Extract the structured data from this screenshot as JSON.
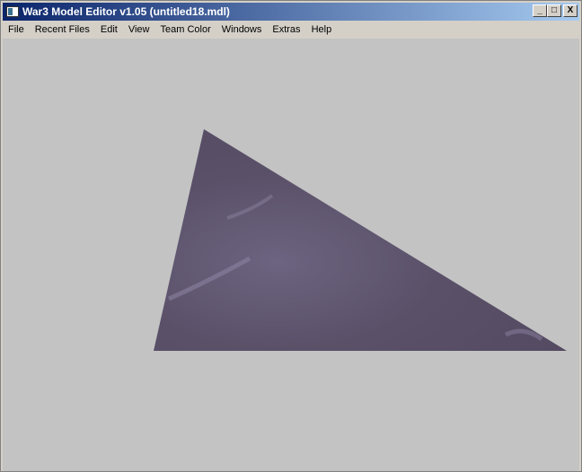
{
  "window": {
    "title": "War3 Model Editor v1.05 (untitled18.mdl)",
    "controls": {
      "minimize": "_",
      "maximize": "□",
      "close": "X"
    }
  },
  "menu": [
    "File",
    "Recent Files",
    "Edit",
    "View",
    "Team Color",
    "Windows",
    "Extras",
    "Help"
  ],
  "colors": {
    "viewport": "#c3c3c3",
    "triangle": "#5a5068"
  }
}
